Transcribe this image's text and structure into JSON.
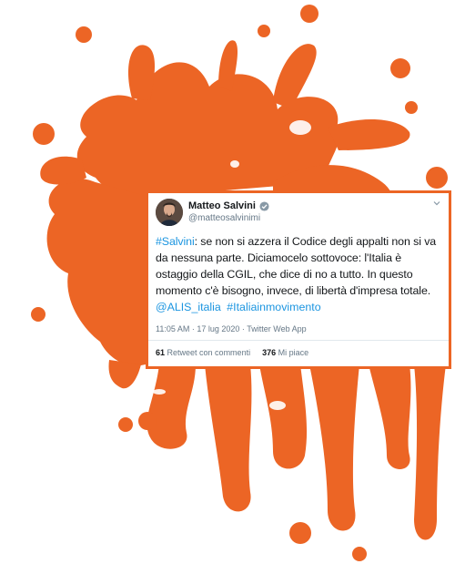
{
  "colors": {
    "splash": "#ec6525",
    "link": "#1b95e0"
  },
  "tweet": {
    "author_name": "Matteo Salvini",
    "author_handle": "@matteosalvinimi",
    "text_hashtag": "#Salvini",
    "text_body": ": se non si azzera il Codice degli appalti non si va da nessuna parte. Diciamocelo sottovoce: l'Italia è ostaggio della CGIL, che dice di no a tutto. In questo momento c'è bisogno, invece, di libertà d'impresa totale.",
    "mention": "@ALIS_italia",
    "hashtag_2": "#Italiainmovimento",
    "meta": "11:05 AM · 17 lug 2020 · Twitter Web App",
    "retweets_count": "61",
    "retweets_label": "Retweet con commenti",
    "likes_count": "376",
    "likes_label": "Mi piace"
  }
}
